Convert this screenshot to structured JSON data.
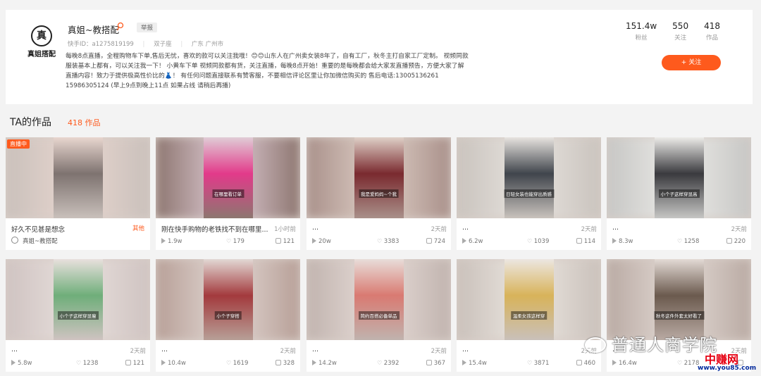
{
  "profile": {
    "avatar_text": "真姐搭配",
    "avatar_mark": "真",
    "name": "真姐~教搭配",
    "report_label": "举报",
    "kuaishou_id": "快手ID：a1275819199",
    "zodiac": "双子座",
    "location": "广东 广州市",
    "bio": [
      "每晚8点直播，全程购物车下单,售后无忧，喜欢的款可以关注我哦！😊😊山东人在广州卖女装8年了，自有工厂，秋冬主打自家工厂定制。  视频同款",
      "服装基本上都有，可以关注我一下！  小黄车下单  视频同款都有货，关注直播，每晚8点开始！重要的是每晚都会给大家发直播预告，方便大家了解",
      "直播内容！致力于提供极高性价比的👗！  有任何问题直接联系有赞客服，不要相信评论区里让你加微信购买的  售后电话:13005136261",
      "15986305124   (早上9点到晚上11点 如果占线 请稍后再播)"
    ],
    "stats": [
      {
        "num": "151.4w",
        "label": "粉丝"
      },
      {
        "num": "550",
        "label": "关注"
      },
      {
        "num": "418",
        "label": "作品"
      }
    ],
    "follow_label": "+ 关注"
  },
  "works": {
    "title": "TA的作品",
    "count": "418 作品"
  },
  "cards": [
    {
      "title": "好久不见甚是想念",
      "tag": "其他",
      "author": "真姐~教搭配",
      "live": "直播中",
      "caption": "",
      "colors": [
        "#c9c0bb",
        "#e8d6cf",
        "#7e7370"
      ]
    },
    {
      "title": "刚在快手购物的老铁找不到在哪里...",
      "time": "1小时前",
      "plays": "1.9w",
      "likes": "179",
      "comments": "121",
      "caption": "在哪里看订单",
      "colors": [
        "#8d7670",
        "#e0ccd6",
        "#e23a8a"
      ]
    },
    {
      "title": "...",
      "time": "2天前",
      "plays": "20w",
      "likes": "3383",
      "comments": "724",
      "caption": "我是爱妈妈~个我",
      "colors": [
        "#a9908a",
        "#dfd0c7",
        "#7a2a2f"
      ]
    },
    {
      "title": "...",
      "time": "2天前",
      "plays": "6.2w",
      "likes": "1039",
      "comments": "114",
      "caption": "日轻女装也能穿出质感",
      "colors": [
        "#c9c3bd",
        "#e7e3df",
        "#40454c"
      ]
    },
    {
      "title": "...",
      "time": "2天前",
      "plays": "8.3w",
      "likes": "1258",
      "comments": "220",
      "caption": "小个子这样穿显高",
      "colors": [
        "#c6c6c4",
        "#ecebe8",
        "#3a3a3e"
      ]
    },
    {
      "title": "...",
      "time": "2天前",
      "plays": "5.8w",
      "likes": "1238",
      "comments": "121",
      "caption": "小个子这样穿显瘦",
      "colors": [
        "#cfc3c1",
        "#e8e0dd",
        "#6fae7a"
      ]
    },
    {
      "title": "...",
      "time": "2天前",
      "plays": "10.4w",
      "likes": "1619",
      "comments": "328",
      "caption": "小个子穿搭",
      "colors": [
        "#b79f97",
        "#e2d8d4",
        "#a33a3d"
      ]
    },
    {
      "title": "...",
      "time": "2天前",
      "plays": "14.2w",
      "likes": "2392",
      "comments": "367",
      "caption": "简约百搭必备单品",
      "colors": [
        "#c0b3ae",
        "#e8ddd9",
        "#d97a72"
      ]
    },
    {
      "title": "...",
      "time": "2天前",
      "plays": "15.4w",
      "likes": "3871",
      "comments": "460",
      "caption": "温柔女孩这样穿",
      "colors": [
        "#c9c0ba",
        "#ece7e1",
        "#d8b35a"
      ]
    },
    {
      "title": "...",
      "time": "2天前",
      "plays": "16.4w",
      "likes": "2178",
      "comments": "",
      "caption": "秋冬这件外套太好看了",
      "colors": [
        "#b9aaa3",
        "#e3dad5",
        "#6b5a4e"
      ]
    }
  ],
  "watermark": {
    "text": "普通人商学院",
    "site_cn": "中赚网",
    "site_url": "www.you85.com"
  },
  "colors": {
    "accent": "#fe5a1d"
  }
}
